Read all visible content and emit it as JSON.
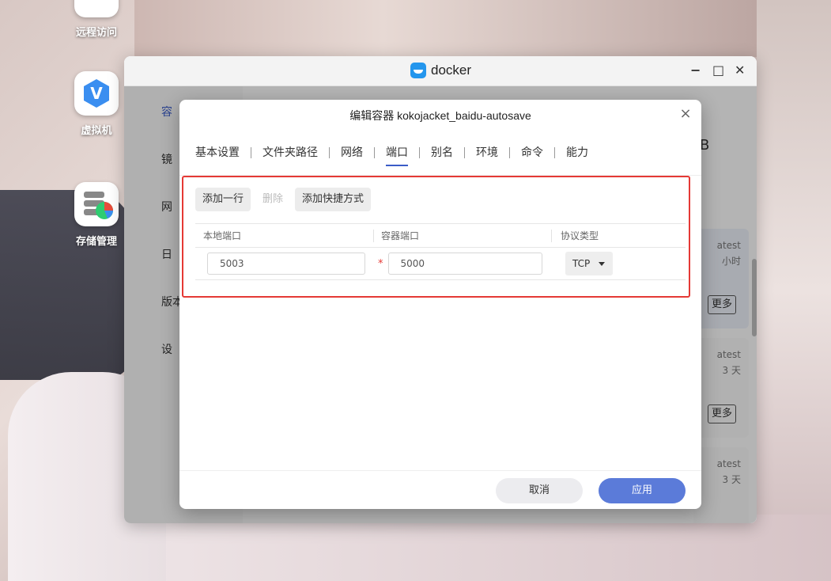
{
  "desktop": {
    "items": [
      {
        "label": "远程访问",
        "icon": "remote-access-icon"
      },
      {
        "label": "虚拟机",
        "icon": "virtual-machine-icon"
      },
      {
        "label": "存储管理",
        "icon": "storage-manager-icon"
      }
    ]
  },
  "docker_window": {
    "title": "docker",
    "sidebar": {
      "items": [
        "容",
        "镜",
        "网",
        "日",
        "版本",
        "设"
      ]
    },
    "cards": [
      {
        "line1": "atest",
        "line2": "小时",
        "button": "更多"
      },
      {
        "line1": "atest",
        "line2": "3 天",
        "button": "更多"
      },
      {
        "line1": "atest",
        "line2": "3 天"
      }
    ],
    "partial_header": "B"
  },
  "dialog": {
    "title": "编辑容器 kokojacket_baidu-autosave",
    "tabs": [
      "基本设置",
      "文件夹路径",
      "网络",
      "端口",
      "别名",
      "环境",
      "命令",
      "能力"
    ],
    "active_tab": "端口",
    "toolbar": {
      "add_row": "添加一行",
      "delete": "删除",
      "add_shortcut": "添加快捷方式"
    },
    "table": {
      "headers": [
        "本地端口",
        "容器端口",
        "协议类型"
      ],
      "rows": [
        {
          "local_port": "5003",
          "container_port": "5000",
          "protocol": "TCP"
        }
      ],
      "required_marker": "*"
    },
    "footer": {
      "cancel": "取消",
      "apply": "应用"
    }
  },
  "colors": {
    "accent": "#5b7bd9",
    "tab_underline": "#3b5cc7",
    "highlight": "#e53935",
    "docker_blue": "#2496ed"
  }
}
